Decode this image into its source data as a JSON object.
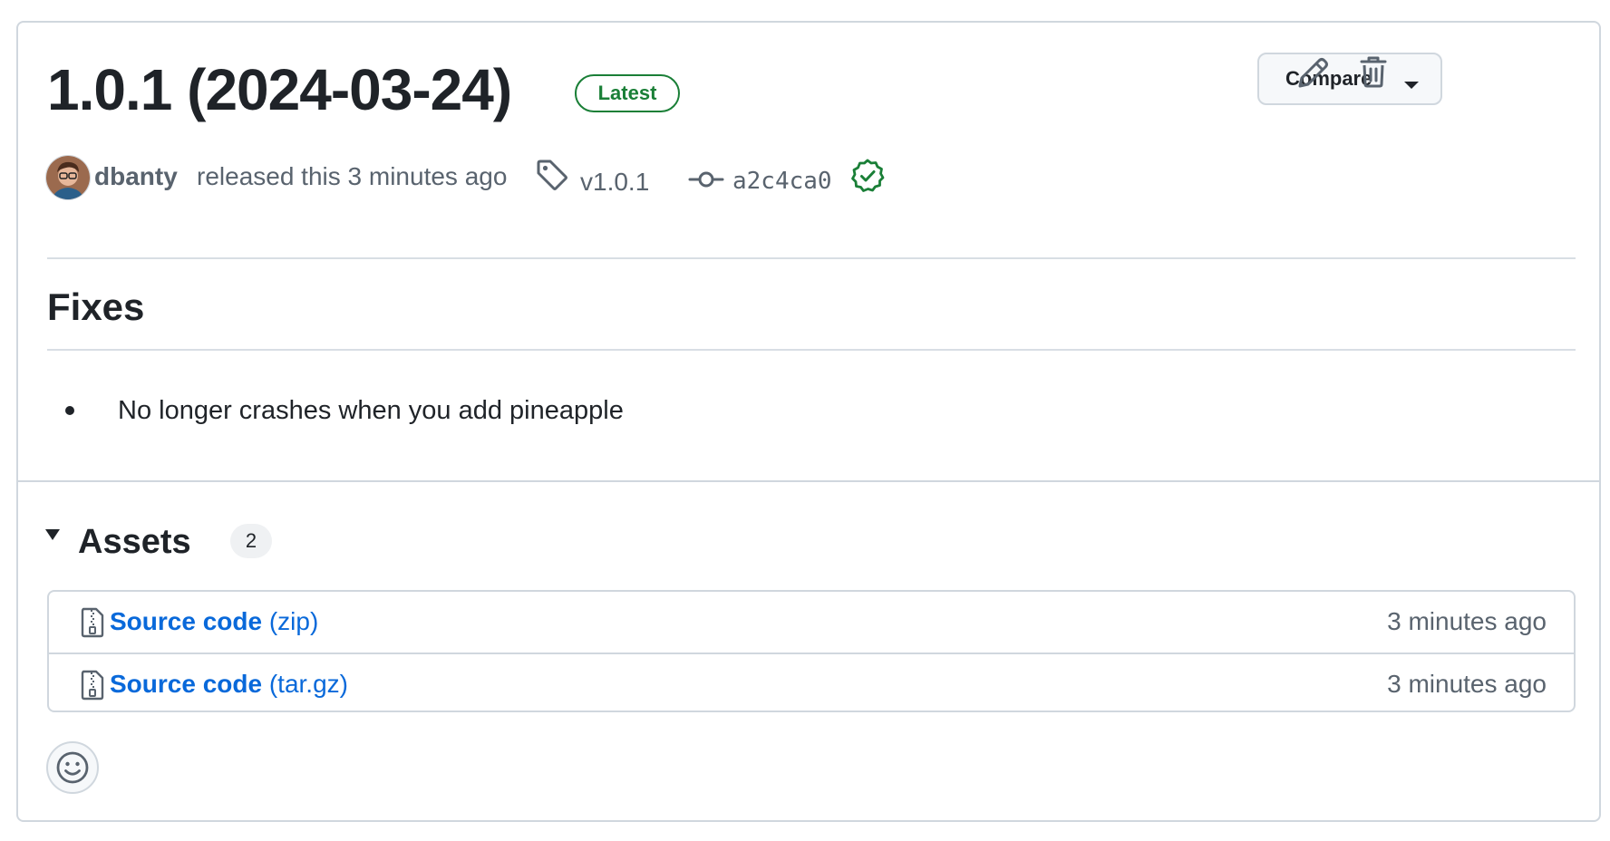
{
  "release": {
    "title": "1.0.1 (2024-03-24)",
    "badge": "Latest",
    "author": "dbanty",
    "released_text": "released this 3 minutes ago",
    "tag": "v1.0.1",
    "commit_sha": "a2c4ca0"
  },
  "actions": {
    "compare_label": "Compare",
    "edit_icon": "pencil-icon",
    "delete_icon": "trash-icon"
  },
  "notes": {
    "heading": "Fixes",
    "items": [
      "No longer crashes when you add pineapple"
    ]
  },
  "assets": {
    "title": "Assets",
    "count": "2",
    "items": [
      {
        "name": "Source code",
        "ext": "(zip)",
        "time": "3 minutes ago"
      },
      {
        "name": "Source code",
        "ext": "(tar.gz)",
        "time": "3 minutes ago"
      }
    ]
  },
  "reactions": {
    "icon": "smiley-icon"
  },
  "colors": {
    "accent_link": "#0969da",
    "success_green": "#1a7f37",
    "muted_text": "#59636e",
    "border": "#d0d7de"
  }
}
